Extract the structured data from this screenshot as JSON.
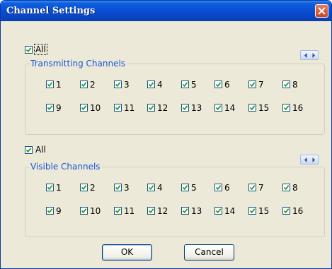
{
  "window": {
    "title": "Channel Settings"
  },
  "transmitting": {
    "all_label": "All",
    "legend": "Transmitting Channels",
    "channels": [
      "1",
      "2",
      "3",
      "4",
      "5",
      "6",
      "7",
      "8",
      "9",
      "10",
      "11",
      "12",
      "13",
      "14",
      "15",
      "16"
    ]
  },
  "visible": {
    "all_label": "All",
    "legend": "Visible Channels",
    "channels": [
      "1",
      "2",
      "3",
      "4",
      "5",
      "6",
      "7",
      "8",
      "9",
      "10",
      "11",
      "12",
      "13",
      "14",
      "15",
      "16"
    ]
  },
  "buttons": {
    "ok": "OK",
    "cancel": "Cancel"
  },
  "icons": {
    "close": "close-icon",
    "scroll": "left-right-arrows-icon",
    "check": "checkmark-icon"
  },
  "colors": {
    "titlebar": "#0a4fd3",
    "legend_text": "#1a55d6",
    "checkmark": "#21a121",
    "close_button": "#d5502f"
  }
}
